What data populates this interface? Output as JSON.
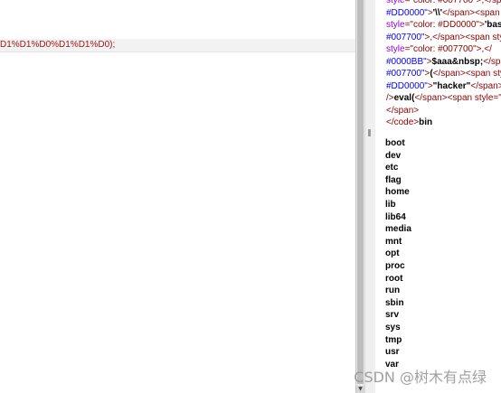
{
  "left_pane": {
    "url_fragment": "D1%D1%D0%D1%D1%D0);"
  },
  "source_lines": [
    [
      {
        "c": "attr",
        "t": "style"
      },
      {
        "c": "tag",
        "t": "=\"color: #007700\">,</"
      },
      {
        "c": "tag",
        "t": "span"
      }
    ],
    [
      {
        "c": "val",
        "t": "#DD0000\""
      },
      {
        "c": "tag",
        "t": ">"
      },
      {
        "c": "txt",
        "t": "'\\\\'"
      },
      {
        "c": "tag",
        "t": "</span><span s"
      }
    ],
    [
      {
        "c": "attr",
        "t": "style"
      },
      {
        "c": "tag",
        "t": "=\"color: #DD0000\">"
      },
      {
        "c": "txt",
        "t": "'bas"
      }
    ],
    [
      {
        "c": "val",
        "t": "#007700\""
      },
      {
        "c": "tag",
        "t": ">,</span><span sty"
      }
    ],
    [
      {
        "c": "attr",
        "t": "style"
      },
      {
        "c": "tag",
        "t": "=\"color: #007700\">,</"
      }
    ],
    [
      {
        "c": "val",
        "t": "#0000BB\""
      },
      {
        "c": "tag",
        "t": ">"
      },
      {
        "c": "txt",
        "t": "$aaa&nbsp;"
      },
      {
        "c": "tag",
        "t": "</sp"
      }
    ],
    [
      {
        "c": "val",
        "t": "#007700\""
      },
      {
        "c": "tag",
        "t": ">"
      },
      {
        "c": "txt",
        "t": "("
      },
      {
        "c": "tag",
        "t": "</span><span sty"
      }
    ],
    [
      {
        "c": "val",
        "t": "#DD0000\""
      },
      {
        "c": "tag",
        "t": ">"
      },
      {
        "c": "txt",
        "t": "\"hacker\""
      },
      {
        "c": "tag",
        "t": "</span>"
      }
    ],
    [
      {
        "c": "tag",
        "t": "/>"
      },
      {
        "c": "txt",
        "t": "eval("
      },
      {
        "c": "tag",
        "t": "</span><span style=\""
      }
    ],
    [
      {
        "c": "tag",
        "t": "</span>"
      }
    ],
    [
      {
        "c": "tag",
        "t": "</code>"
      },
      {
        "c": "txt",
        "t": "bin"
      }
    ]
  ],
  "output_list": [
    "boot",
    "dev",
    "etc",
    "flag",
    "home",
    "lib",
    "lib64",
    "media",
    "mnt",
    "opt",
    "proc",
    "root",
    "run",
    "sbin",
    "srv",
    "sys",
    "tmp",
    "usr",
    "var"
  ],
  "watermark": "CSDN @树木有点绿"
}
